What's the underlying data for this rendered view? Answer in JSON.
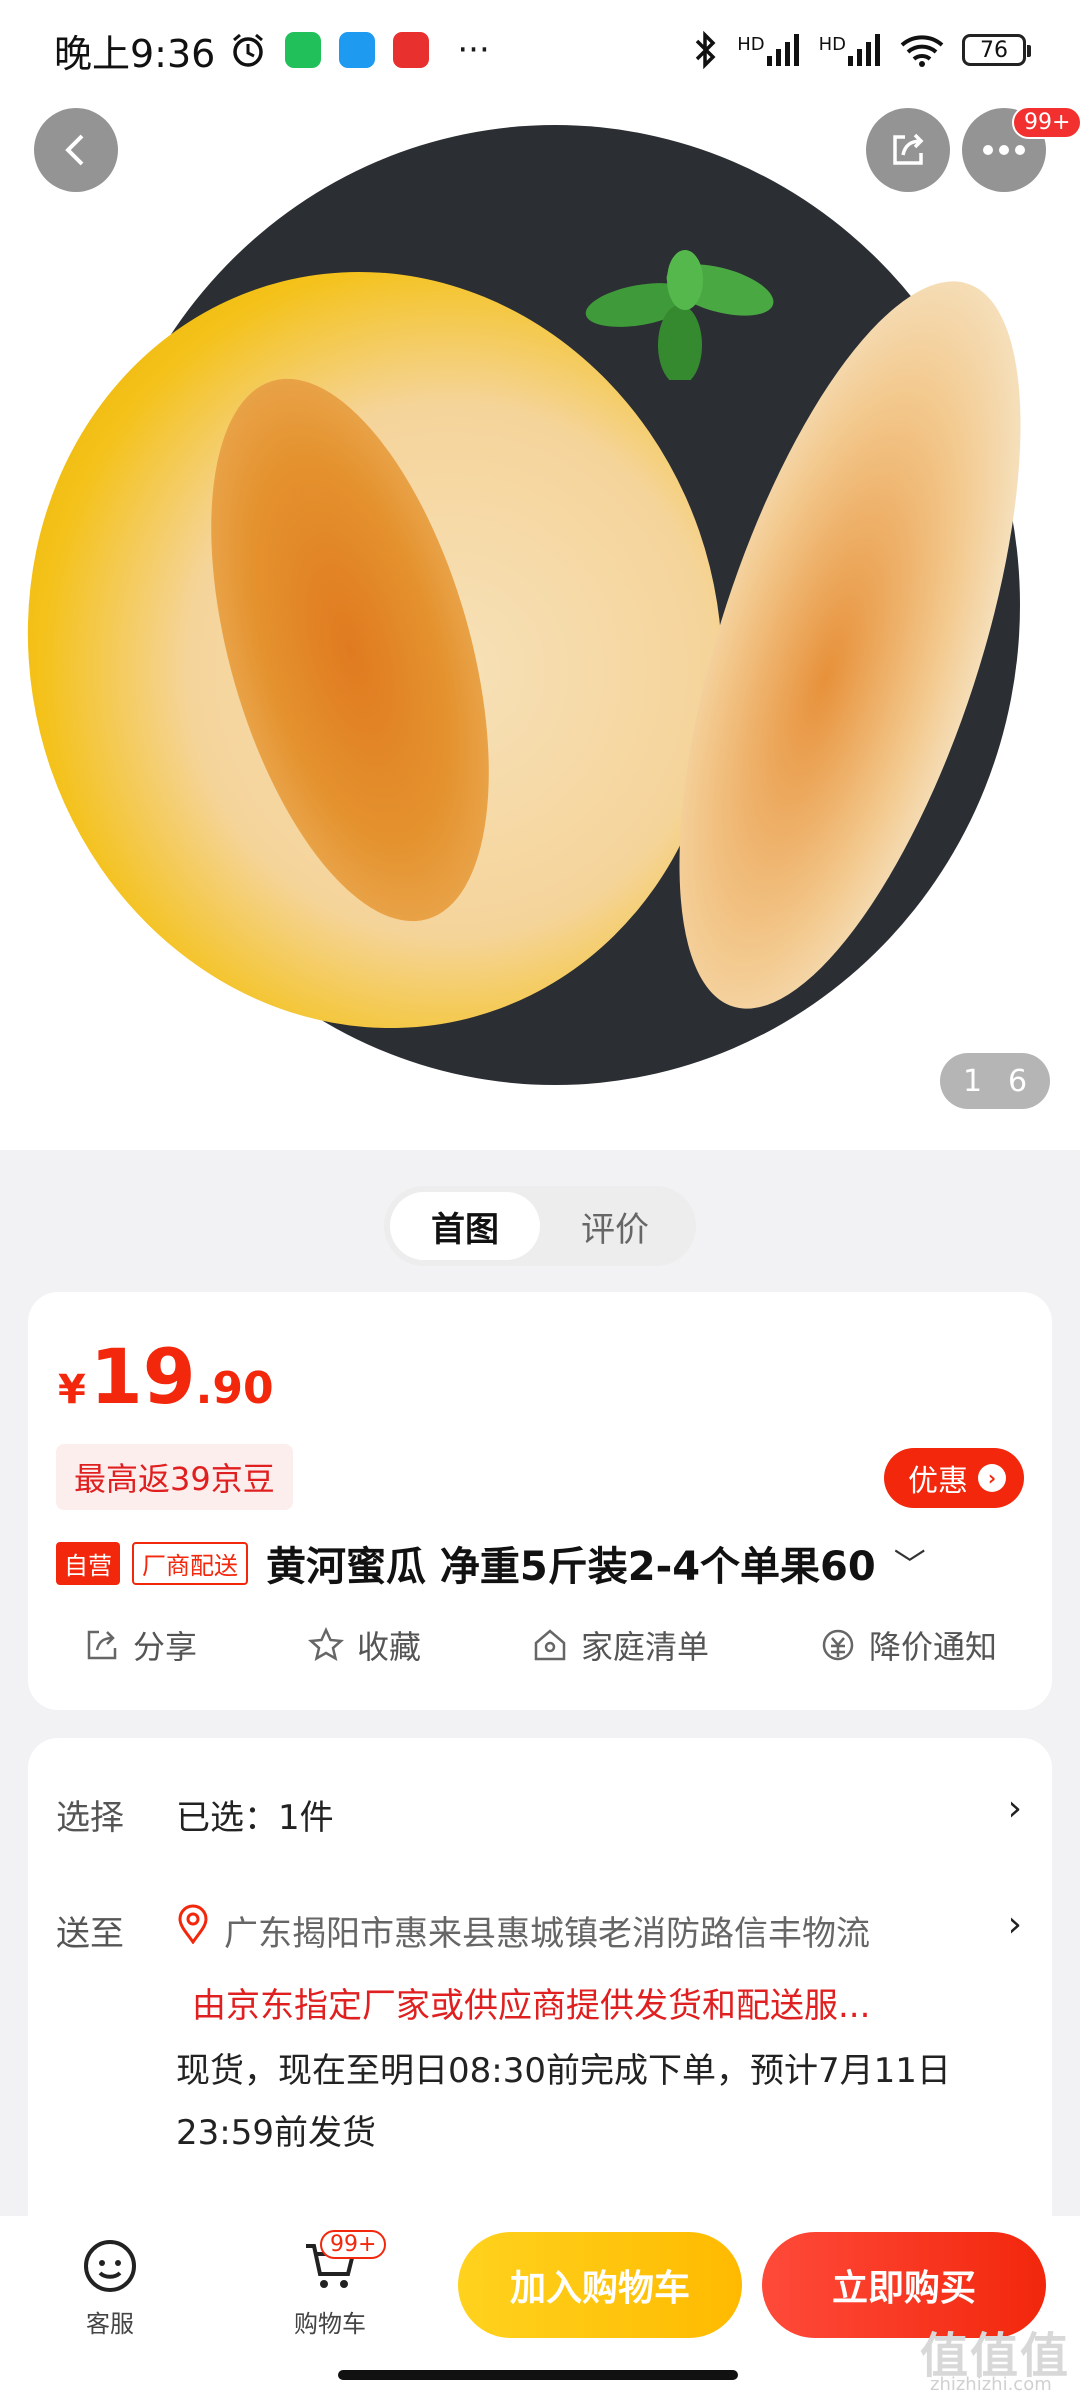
{
  "status_bar": {
    "time": "晚上9:36",
    "more": "···",
    "battery": "76",
    "hd1": "HD",
    "hd2": "HD"
  },
  "gallery": {
    "current": "1",
    "total": "6",
    "more_badge": "99+"
  },
  "tabs": [
    {
      "label": "首图",
      "active": true
    },
    {
      "label": "评价",
      "active": false
    }
  ],
  "product": {
    "price_symbol": "¥",
    "price_int": "19",
    "price_dec": ".90",
    "rebate_text": "最高返39京豆",
    "coupon_label": "优惠",
    "tag_self": "自营",
    "tag_factory": "厂商配送",
    "title": "黄河蜜瓜 净重5斤装2-4个单果60",
    "actions": [
      {
        "label": "分享",
        "icon": "share-icon"
      },
      {
        "label": "收藏",
        "icon": "star-icon"
      },
      {
        "label": "家庭清单",
        "icon": "house-icon"
      },
      {
        "label": "降价通知",
        "icon": "price-drop-icon"
      }
    ]
  },
  "details": {
    "select_label": "选择",
    "select_value": "已选：1件",
    "ship_label": "送至",
    "address": "广东揭阳市惠来县惠城镇老消防路信丰物流",
    "notice": "由京东指定厂家或供应商提供发货和配送服...",
    "delivery": "现货，现在至明日08:30前完成下单，预计7月11日23:59前发货"
  },
  "bottom_bar": {
    "service_label": "客服",
    "cart_label": "购物车",
    "cart_badge": "99+",
    "add_to_cart": "加入购物车",
    "buy_now": "立即购买"
  },
  "watermark": {
    "text": "值值值",
    "sub": "zhizhizhi.com"
  },
  "colors": {
    "accent_red": "#f2270c",
    "add_cart_yellow": "#ffc107"
  }
}
